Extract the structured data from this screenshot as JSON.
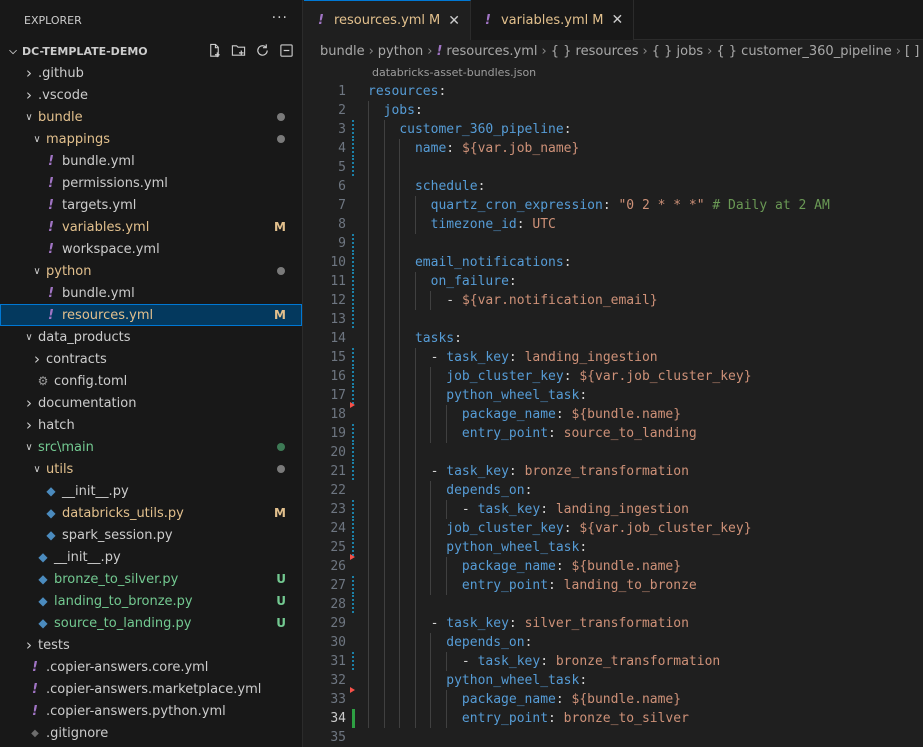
{
  "explorer": {
    "title": "EXPLORER",
    "more": "···",
    "project": "DC-TEMPLATE-DEMO",
    "tree": [
      {
        "label": ".github",
        "type": "folder",
        "depth": 1,
        "open": false
      },
      {
        "label": ".vscode",
        "type": "folder",
        "depth": 1,
        "open": false
      },
      {
        "label": "bundle",
        "type": "folder",
        "depth": 1,
        "open": true,
        "dot": "gray",
        "color": "mod"
      },
      {
        "label": "mappings",
        "type": "folder",
        "depth": 2,
        "open": true,
        "dot": "gray",
        "color": "mod"
      },
      {
        "label": "bundle.yml",
        "type": "yaml",
        "depth": 3
      },
      {
        "label": "permissions.yml",
        "type": "yaml",
        "depth": 3
      },
      {
        "label": "targets.yml",
        "type": "yaml",
        "depth": 3
      },
      {
        "label": "variables.yml",
        "type": "yaml",
        "depth": 3,
        "status": "M",
        "color": "mod"
      },
      {
        "label": "workspace.yml",
        "type": "yaml",
        "depth": 3
      },
      {
        "label": "python",
        "type": "folder",
        "depth": 2,
        "open": true,
        "dot": "gray",
        "color": "mod"
      },
      {
        "label": "bundle.yml",
        "type": "yaml",
        "depth": 3
      },
      {
        "label": "resources.yml",
        "type": "yaml",
        "depth": 3,
        "status": "M",
        "color": "mod",
        "selected": true
      },
      {
        "label": "data_products",
        "type": "folder",
        "depth": 1,
        "open": true
      },
      {
        "label": "contracts",
        "type": "folder",
        "depth": 2,
        "open": false
      },
      {
        "label": "config.toml",
        "type": "gear",
        "depth": 2
      },
      {
        "label": "documentation",
        "type": "folder",
        "depth": 1,
        "open": false
      },
      {
        "label": "hatch",
        "type": "folder",
        "depth": 1,
        "open": false
      },
      {
        "label": "src\\main",
        "type": "folder",
        "depth": 1,
        "open": true,
        "dot": "green",
        "color": "green"
      },
      {
        "label": "utils",
        "type": "folder",
        "depth": 2,
        "open": true,
        "dot": "gray",
        "color": "mod"
      },
      {
        "label": "__init__.py",
        "type": "py",
        "depth": 3
      },
      {
        "label": "databricks_utils.py",
        "type": "py",
        "depth": 3,
        "status": "M",
        "color": "mod"
      },
      {
        "label": "spark_session.py",
        "type": "py",
        "depth": 3
      },
      {
        "label": "__init__.py",
        "type": "py",
        "depth": 2
      },
      {
        "label": "bronze_to_silver.py",
        "type": "py",
        "depth": 2,
        "status": "U",
        "color": "green"
      },
      {
        "label": "landing_to_bronze.py",
        "type": "py",
        "depth": 2,
        "status": "U",
        "color": "green"
      },
      {
        "label": "source_to_landing.py",
        "type": "py",
        "depth": 2,
        "status": "U",
        "color": "green"
      },
      {
        "label": "tests",
        "type": "folder",
        "depth": 1,
        "open": false
      },
      {
        "label": ".copier-answers.core.yml",
        "type": "yaml",
        "depth": 1
      },
      {
        "label": ".copier-answers.marketplace.yml",
        "type": "yaml",
        "depth": 1
      },
      {
        "label": ".copier-answers.python.yml",
        "type": "yaml",
        "depth": 1
      },
      {
        "label": ".gitignore",
        "type": "diamond",
        "depth": 1
      }
    ]
  },
  "tabs": [
    {
      "label": "resources.yml",
      "dirty": "M",
      "active": true
    },
    {
      "label": "variables.yml",
      "dirty": "M",
      "active": false
    }
  ],
  "breadcrumbs": [
    "bundle",
    "python",
    "resources.yml",
    "{ } resources",
    "{ } jobs",
    "{ } customer_360_pipeline",
    "[ ] tasks"
  ],
  "codelens": "databricks-asset-bundles.json",
  "code": [
    {
      "n": "1",
      "i": 0,
      "t": [
        [
          "k",
          "resources"
        ],
        [
          "p",
          ":"
        ]
      ],
      "g": ""
    },
    {
      "n": "2",
      "i": 1,
      "t": [
        [
          "k",
          "jobs"
        ],
        [
          "p",
          ":"
        ]
      ],
      "g": ""
    },
    {
      "n": "3",
      "i": 2,
      "t": [
        [
          "k",
          "customer_360_pipeline"
        ],
        [
          "p",
          ":"
        ]
      ],
      "g": "mod"
    },
    {
      "n": "4",
      "i": 3,
      "t": [
        [
          "k",
          "name"
        ],
        [
          "p",
          ": "
        ],
        [
          "v",
          "${var.job_name}"
        ]
      ],
      "g": "mod"
    },
    {
      "n": "5",
      "i": 0,
      "t": [],
      "g": "mod"
    },
    {
      "n": "6",
      "i": 3,
      "t": [
        [
          "k",
          "schedule"
        ],
        [
          "p",
          ":"
        ]
      ],
      "g": ""
    },
    {
      "n": "7",
      "i": 4,
      "t": [
        [
          "k",
          "quartz_cron_expression"
        ],
        [
          "p",
          ": "
        ],
        [
          "v",
          "\"0 2 * * *\""
        ],
        [
          "c",
          " # Daily at 2 AM"
        ]
      ],
      "g": ""
    },
    {
      "n": "8",
      "i": 4,
      "t": [
        [
          "k",
          "timezone_id"
        ],
        [
          "p",
          ": "
        ],
        [
          "v",
          "UTC"
        ]
      ],
      "g": ""
    },
    {
      "n": "9",
      "i": 0,
      "t": [],
      "g": "mod"
    },
    {
      "n": "10",
      "i": 3,
      "t": [
        [
          "k",
          "email_notifications"
        ],
        [
          "p",
          ":"
        ]
      ],
      "g": "mod"
    },
    {
      "n": "11",
      "i": 4,
      "t": [
        [
          "k",
          "on_failure"
        ],
        [
          "p",
          ":"
        ]
      ],
      "g": "mod"
    },
    {
      "n": "12",
      "i": 5,
      "t": [
        [
          "p",
          "- "
        ],
        [
          "v",
          "${var.notification_email}"
        ]
      ],
      "g": "mod"
    },
    {
      "n": "13",
      "i": 0,
      "t": [],
      "g": "mod"
    },
    {
      "n": "14",
      "i": 3,
      "t": [
        [
          "k",
          "tasks"
        ],
        [
          "p",
          ":"
        ]
      ],
      "g": ""
    },
    {
      "n": "15",
      "i": 4,
      "t": [
        [
          "p",
          "- "
        ],
        [
          "k",
          "task_key"
        ],
        [
          "p",
          ": "
        ],
        [
          "v",
          "landing_ingestion"
        ]
      ],
      "g": "mod"
    },
    {
      "n": "16",
      "i": 5,
      "t": [
        [
          "k",
          "job_cluster_key"
        ],
        [
          "p",
          ": "
        ],
        [
          "v",
          "${var.job_cluster_key}"
        ]
      ],
      "g": "mod"
    },
    {
      "n": "17",
      "i": 5,
      "t": [
        [
          "k",
          "python_wheel_task"
        ],
        [
          "p",
          ":"
        ]
      ],
      "g": "mod"
    },
    {
      "n": "18",
      "i": 6,
      "t": [
        [
          "k",
          "package_name"
        ],
        [
          "p",
          ": "
        ],
        [
          "v",
          "${bundle.name}"
        ]
      ],
      "g": "del"
    },
    {
      "n": "19",
      "i": 6,
      "t": [
        [
          "k",
          "entry_point"
        ],
        [
          "p",
          ": "
        ],
        [
          "v",
          "source_to_landing"
        ]
      ],
      "g": "mod"
    },
    {
      "n": "20",
      "i": 0,
      "t": [],
      "g": "mod"
    },
    {
      "n": "21",
      "i": 4,
      "t": [
        [
          "p",
          "- "
        ],
        [
          "k",
          "task_key"
        ],
        [
          "p",
          ": "
        ],
        [
          "v",
          "bronze_transformation"
        ]
      ],
      "g": "mod"
    },
    {
      "n": "22",
      "i": 5,
      "t": [
        [
          "k",
          "depends_on"
        ],
        [
          "p",
          ":"
        ]
      ],
      "g": ""
    },
    {
      "n": "23",
      "i": 6,
      "t": [
        [
          "p",
          "- "
        ],
        [
          "k",
          "task_key"
        ],
        [
          "p",
          ": "
        ],
        [
          "v",
          "landing_ingestion"
        ]
      ],
      "g": "mod"
    },
    {
      "n": "24",
      "i": 5,
      "t": [
        [
          "k",
          "job_cluster_key"
        ],
        [
          "p",
          ": "
        ],
        [
          "v",
          "${var.job_cluster_key}"
        ]
      ],
      "g": "mod"
    },
    {
      "n": "25",
      "i": 5,
      "t": [
        [
          "k",
          "python_wheel_task"
        ],
        [
          "p",
          ":"
        ]
      ],
      "g": "mod"
    },
    {
      "n": "26",
      "i": 6,
      "t": [
        [
          "k",
          "package_name"
        ],
        [
          "p",
          ": "
        ],
        [
          "v",
          "${bundle.name}"
        ]
      ],
      "g": "del"
    },
    {
      "n": "27",
      "i": 6,
      "t": [
        [
          "k",
          "entry_point"
        ],
        [
          "p",
          ": "
        ],
        [
          "v",
          "landing_to_bronze"
        ]
      ],
      "g": "mod"
    },
    {
      "n": "28",
      "i": 0,
      "t": [],
      "g": "mod"
    },
    {
      "n": "29",
      "i": 4,
      "t": [
        [
          "p",
          "- "
        ],
        [
          "k",
          "task_key"
        ],
        [
          "p",
          ": "
        ],
        [
          "v",
          "silver_transformation"
        ]
      ],
      "g": ""
    },
    {
      "n": "30",
      "i": 5,
      "t": [
        [
          "k",
          "depends_on"
        ],
        [
          "p",
          ":"
        ]
      ],
      "g": ""
    },
    {
      "n": "31",
      "i": 6,
      "t": [
        [
          "p",
          "- "
        ],
        [
          "k",
          "task_key"
        ],
        [
          "p",
          ": "
        ],
        [
          "v",
          "bronze_transformation"
        ]
      ],
      "g": "mod"
    },
    {
      "n": "32",
      "i": 5,
      "t": [
        [
          "k",
          "python_wheel_task"
        ],
        [
          "p",
          ":"
        ]
      ],
      "g": ""
    },
    {
      "n": "33",
      "i": 6,
      "t": [
        [
          "k",
          "package_name"
        ],
        [
          "p",
          ": "
        ],
        [
          "v",
          "${bundle.name}"
        ]
      ],
      "g": "del"
    },
    {
      "n": "34",
      "i": 6,
      "t": [
        [
          "k",
          "entry_point"
        ],
        [
          "p",
          ": "
        ],
        [
          "v",
          "bronze_to_silver"
        ]
      ],
      "g": "add",
      "current": true
    },
    {
      "n": "35",
      "i": 0,
      "t": [],
      "g": ""
    }
  ]
}
